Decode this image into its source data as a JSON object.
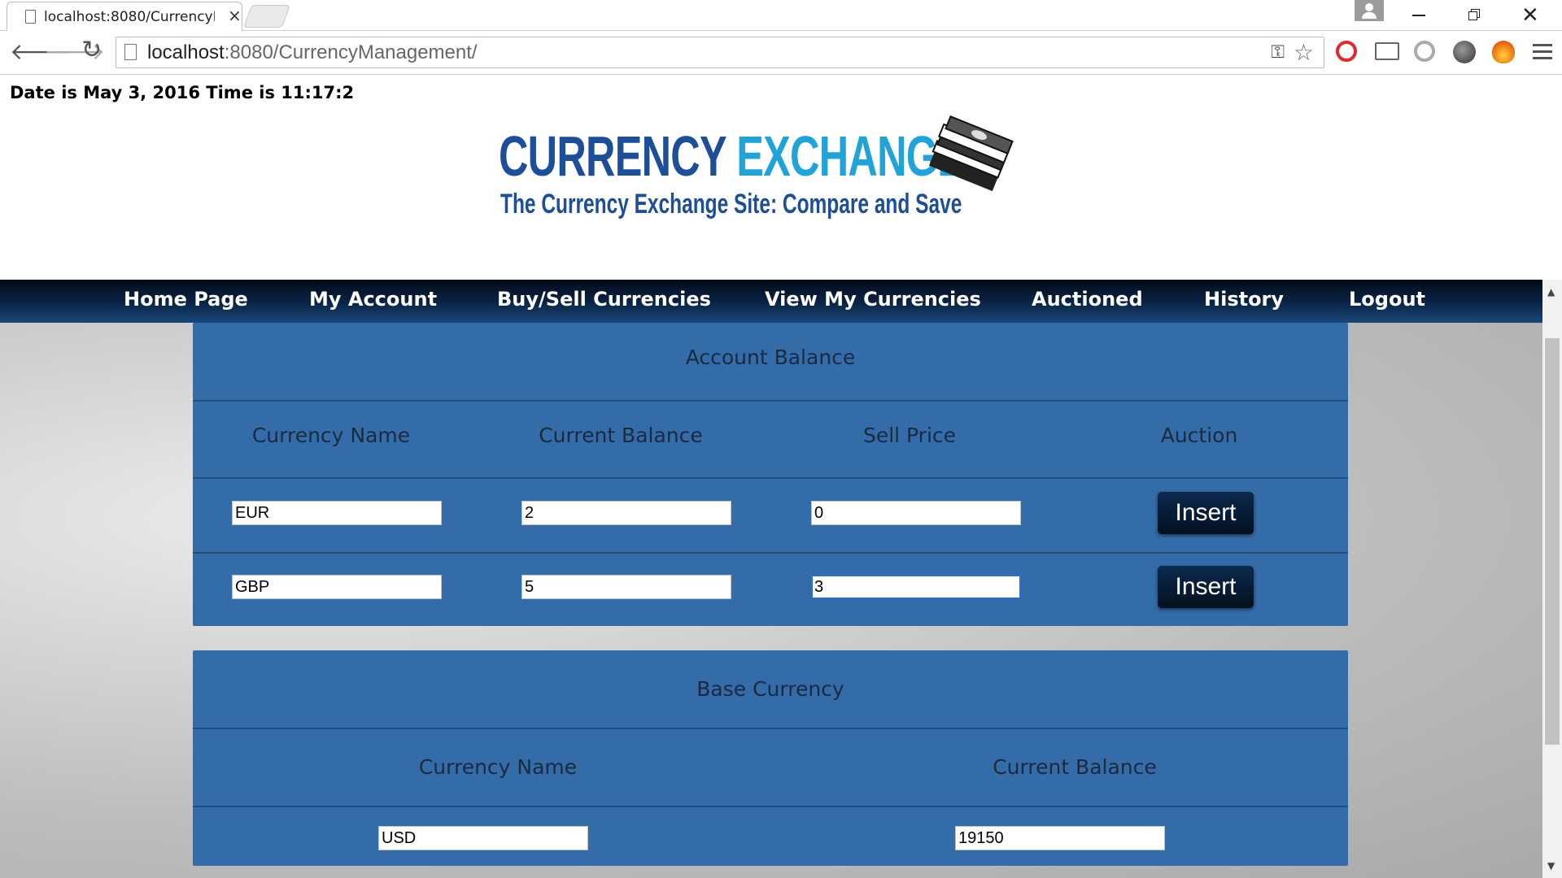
{
  "browser": {
    "tab_title": "localhost:8080/CurrencyM",
    "tab_close": "×",
    "url_host": "localhost",
    "url_path": ":8080/CurrencyManagement/"
  },
  "page": {
    "datetime": "Date is May 3, 2016 Time is 11:17:2",
    "logo": {
      "word1": "CURRENCY",
      "word2": "EXCHANGE",
      "tagline": "The Currency Exchange Site: Compare and Save"
    },
    "nav": [
      {
        "label": "Home Page"
      },
      {
        "label": "My Account"
      },
      {
        "label": "Buy/Sell Currencies"
      },
      {
        "label": "View My Currencies"
      },
      {
        "label": "Auctioned"
      },
      {
        "label": "History"
      },
      {
        "label": "Logout"
      }
    ],
    "account_balance": {
      "title": "Account Balance",
      "headers": [
        "Currency Name",
        "Current Balance",
        "Sell Price",
        "Auction"
      ],
      "rows": [
        {
          "currency": "EUR",
          "balance": "2",
          "sell_price": "0",
          "action": "Insert"
        },
        {
          "currency": "GBP",
          "balance": "5",
          "sell_price": "3",
          "action": "Insert"
        }
      ]
    },
    "base_currency": {
      "title": "Base Currency",
      "headers": [
        "Currency Name",
        "Current Balance"
      ],
      "rows": [
        {
          "currency": "USD",
          "balance": "19150"
        }
      ]
    }
  },
  "colors": {
    "panel": "#346ba9",
    "navbar": "#0a2547",
    "logo_dark": "#1d4e9a",
    "logo_light": "#1fa3d8"
  }
}
